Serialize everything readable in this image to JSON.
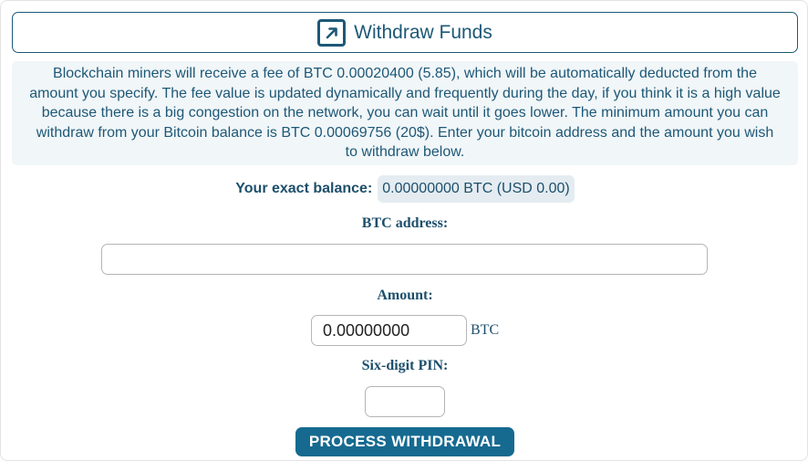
{
  "header": {
    "title": "Withdraw Funds",
    "icon": "external-link-arrow-icon"
  },
  "info": {
    "text": "Blockchain miners will receive a fee of BTC 0.00020400 (5.85), which will be automatically deducted from the amount you specify. The fee value is updated dynamically and frequently during the day, if you think it is a high value because there is a big congestion on the network, you can wait until it goes lower. The minimum amount you can withdraw from your Bitcoin balance is BTC 0.00069756 (20$). Enter your bitcoin address and the amount you wish to withdraw below."
  },
  "balance": {
    "label": "Your exact balance:",
    "value": "0.00000000 BTC (USD 0.00)"
  },
  "form": {
    "address_label": "BTC address:",
    "address_value": "",
    "amount_label": "Amount:",
    "amount_value": "0.00000000",
    "amount_unit": "BTC",
    "pin_label": "Six-digit PIN:",
    "pin_value": "",
    "submit_label": "PROCESS WITHDRAWAL"
  },
  "colors": {
    "primary": "#1d5877",
    "button": "#166a90",
    "info_bg": "#f1f6f8",
    "balance_bg": "#e4ecf1"
  }
}
